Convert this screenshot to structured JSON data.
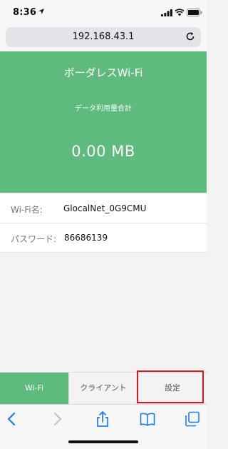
{
  "status_bar": {
    "time": "8:36"
  },
  "browser": {
    "url": "192.168.43.1"
  },
  "hero": {
    "title": "ボーダレスWi-Fi",
    "subtitle": "データ利用量合計",
    "amount": "0.00 MB",
    "color": "#5fba7d"
  },
  "info": {
    "wifi_name_label": "Wi-Fi名:",
    "wifi_name_value": "GlocalNet_0G9CMU",
    "password_label": "パスワード:",
    "password_value": "86686139"
  },
  "tabs": [
    {
      "label": "Wi-Fi",
      "active": true
    },
    {
      "label": "クライアント",
      "active": false
    },
    {
      "label": "設定",
      "active": false
    }
  ],
  "toolbar_icons": [
    "back-icon",
    "forward-icon",
    "share-icon",
    "bookmarks-icon",
    "tabs-icon"
  ],
  "accent_color": "#1a7cf5",
  "highlight_color": "#e3151a"
}
